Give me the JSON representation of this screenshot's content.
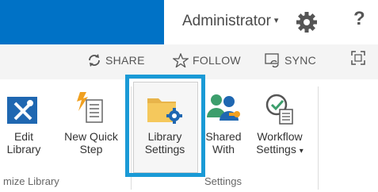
{
  "suitebar": {
    "user": "Administrator",
    "user_caret": "▾",
    "help": "?"
  },
  "actions": {
    "share": "SHARE",
    "follow": "FOLLOW",
    "sync": "SYNC"
  },
  "ribbon": {
    "edit_library": [
      "Edit",
      "Library"
    ],
    "new_quick_step": [
      "New Quick",
      "Step"
    ],
    "library_settings": [
      "Library",
      "Settings"
    ],
    "shared_with": [
      "Shared",
      "With"
    ],
    "workflow_settings": [
      "Workflow",
      "Settings",
      "▾"
    ],
    "group_customize": "mize Library",
    "group_settings": "Settings"
  },
  "colors": {
    "brand": "#0072c6",
    "highlight": "#1a9ad6"
  }
}
